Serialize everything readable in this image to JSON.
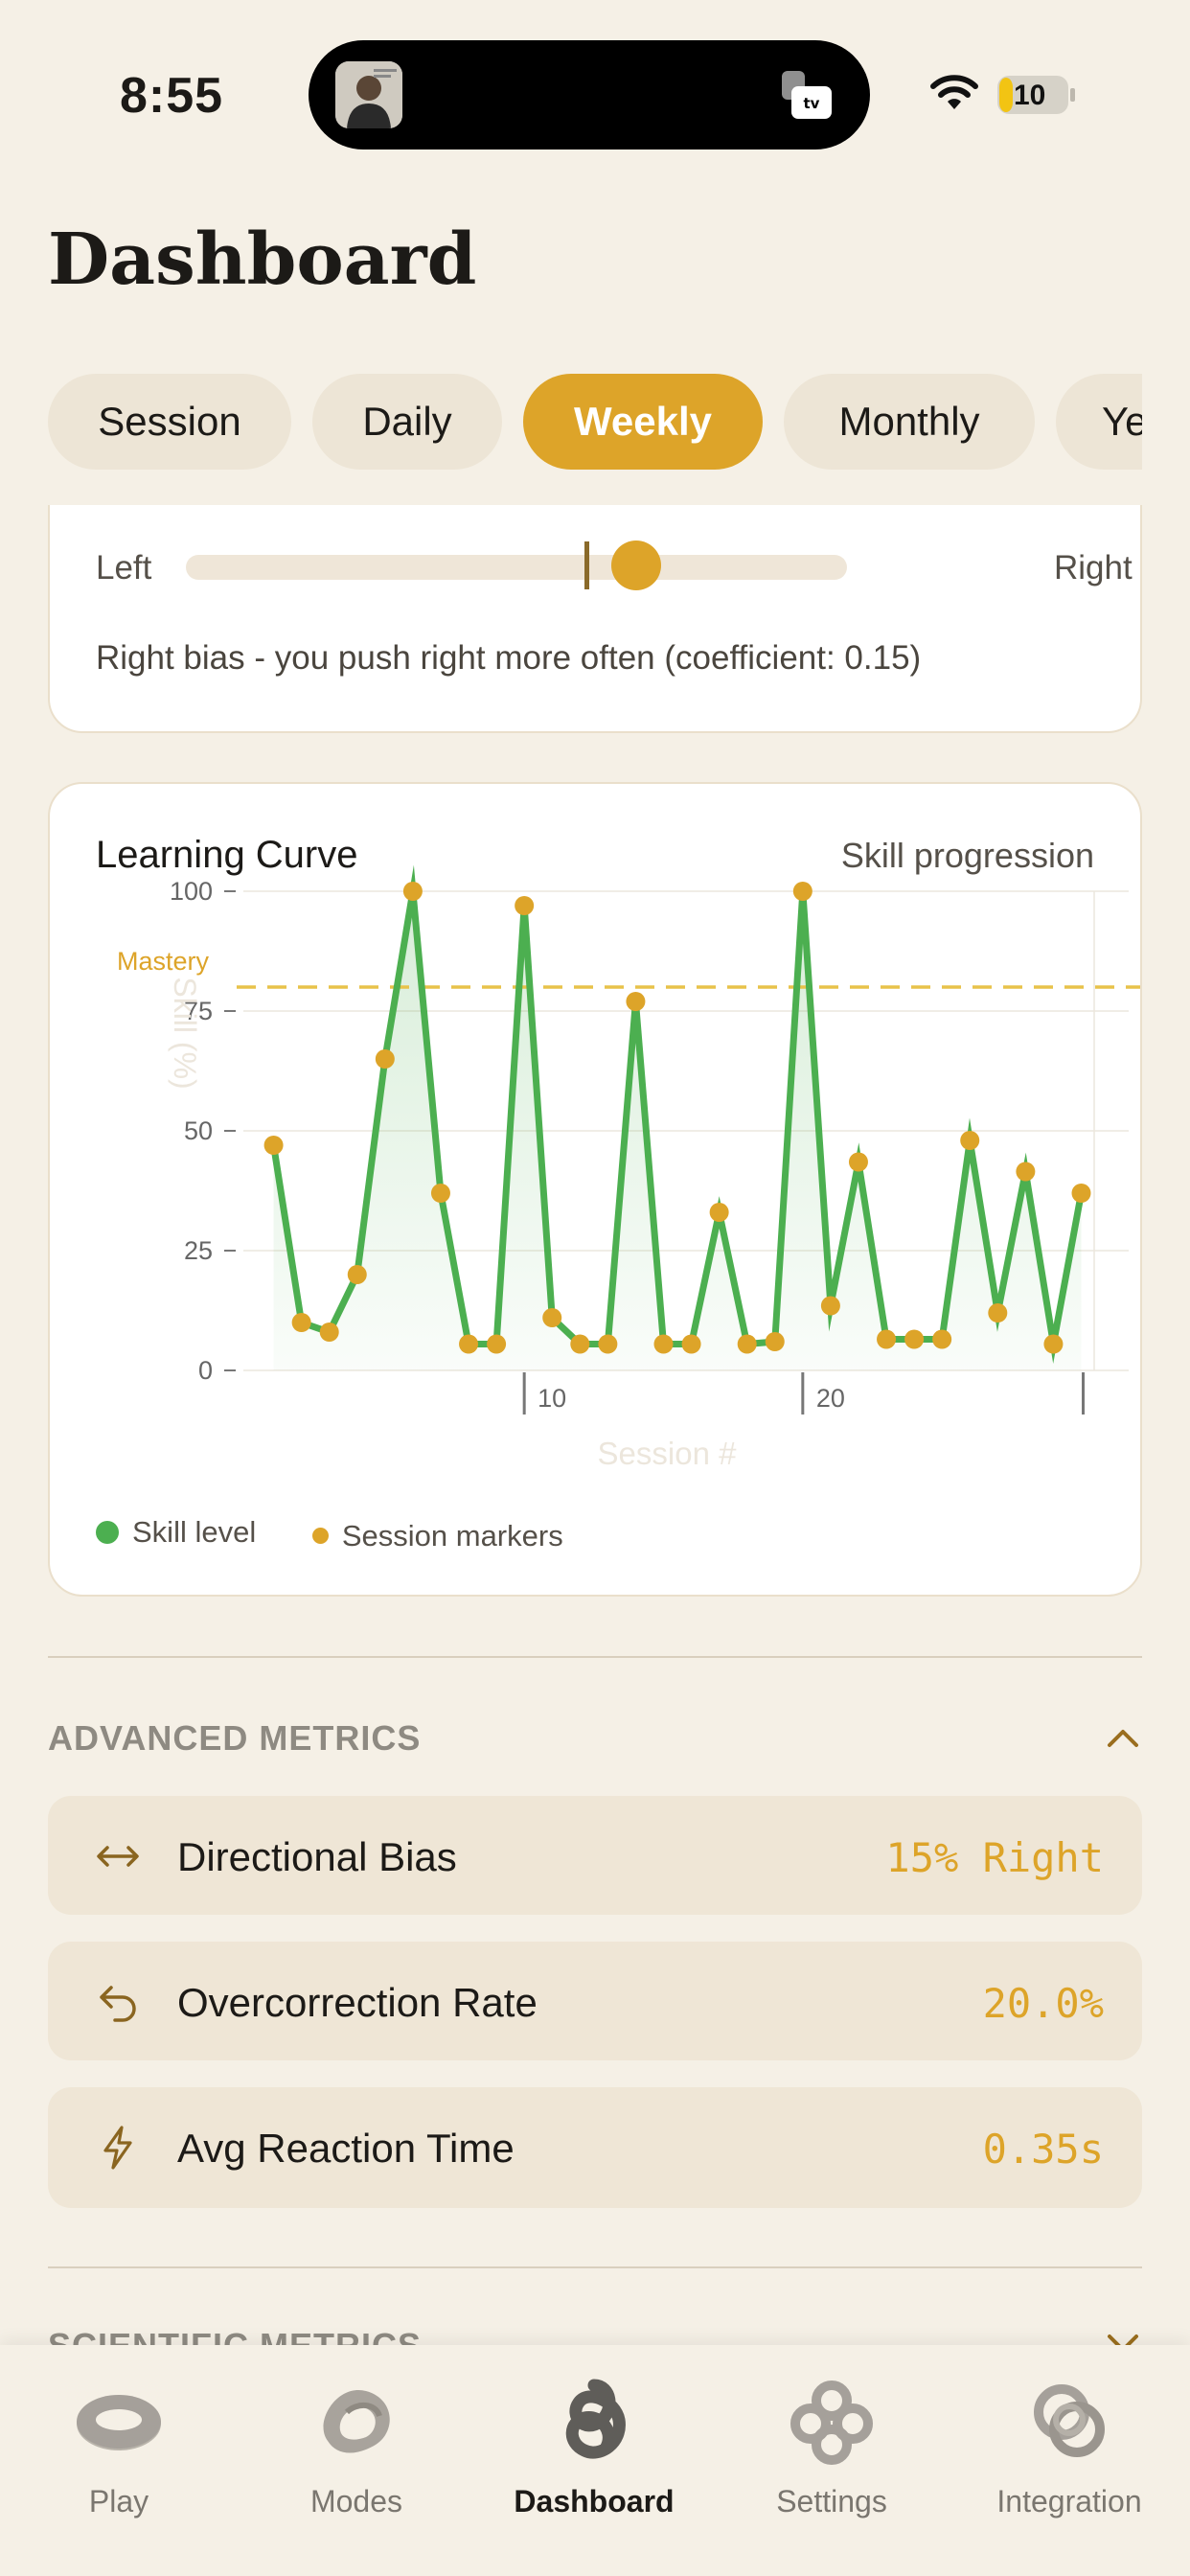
{
  "status": {
    "time": "8:55",
    "battery": "10"
  },
  "header": {
    "title": "Dashboard"
  },
  "tabs": [
    {
      "label": "Session",
      "active": false
    },
    {
      "label": "Daily",
      "active": false
    },
    {
      "label": "Weekly",
      "active": true
    },
    {
      "label": "Monthly",
      "active": false
    },
    {
      "label": "Ye",
      "active": false
    }
  ],
  "bias_card": {
    "left_label": "Left",
    "right_label": "Right",
    "bias_value": 0.15,
    "description": "Right bias - you push right more often (coefficient: 0.15)"
  },
  "learning_curve": {
    "title": "Learning Curve",
    "subtitle": "Skill progression",
    "legend": {
      "skill": "Skill level",
      "markers": "Session markers"
    }
  },
  "chart_data": {
    "type": "line",
    "title": "Learning Curve",
    "xlabel": "Session #",
    "ylabel": "Skill (%)",
    "ylim": [
      0,
      100
    ],
    "yticks": [
      0,
      25,
      50,
      75,
      100
    ],
    "xlim": [
      0,
      30
    ],
    "xticks": [
      10,
      20
    ],
    "grid": true,
    "threshold": {
      "label": "Mastery",
      "value": 80
    },
    "x": [
      1,
      2,
      3,
      4,
      5,
      6,
      7,
      8,
      9,
      10,
      11,
      12,
      13,
      14,
      15,
      16,
      17,
      18,
      19,
      20,
      21,
      22,
      23,
      24,
      25,
      26,
      27,
      28,
      29,
      30
    ],
    "series": [
      {
        "name": "Skill level",
        "values": [
          47,
          10,
          8,
          20,
          65,
          100,
          37,
          5.5,
          5.5,
          97,
          11,
          5.5,
          5.5,
          77,
          5.5,
          5.5,
          33,
          5.5,
          6,
          100,
          13.5,
          43.5,
          6.5,
          6.5,
          6.5,
          48,
          12,
          41.5,
          5.5,
          37
        ]
      }
    ],
    "legend": [
      "Skill level",
      "Session markers"
    ],
    "legend_position": "bottom-left",
    "colors": {
      "line": "#4caf50",
      "markers": "#dda429",
      "threshold": "#e8c24a"
    }
  },
  "advanced": {
    "title": "ADVANCED METRICS",
    "metrics": [
      {
        "icon": "arrows-horizontal-icon",
        "label": "Directional Bias",
        "value": "15% Right"
      },
      {
        "icon": "undo-arrow-icon",
        "label": "Overcorrection Rate",
        "value": "20.0%"
      },
      {
        "icon": "lightning-icon",
        "label": "Avg Reaction Time",
        "value": "0.35s"
      }
    ]
  },
  "scientific": {
    "title": "SCIENTIFIC METRICS"
  },
  "nav": [
    {
      "label": "Play",
      "icon": "torus-icon"
    },
    {
      "label": "Modes",
      "icon": "twisted-torus-icon"
    },
    {
      "label": "Dashboard",
      "icon": "knot-icon",
      "active": true
    },
    {
      "label": "Settings",
      "icon": "clover-icon"
    },
    {
      "label": "Integration",
      "icon": "linked-rings-icon"
    }
  ]
}
